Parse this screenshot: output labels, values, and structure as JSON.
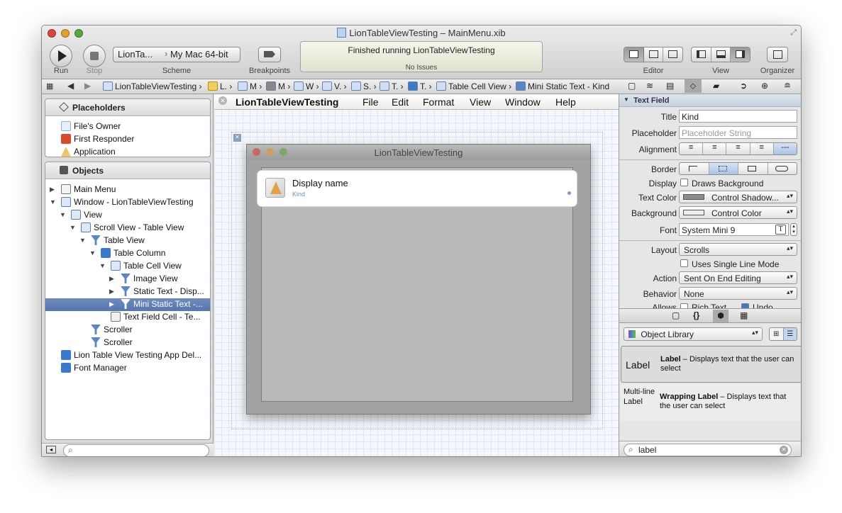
{
  "window": {
    "title": "LionTableViewTesting – MainMenu.xib"
  },
  "toolbar": {
    "run_label": "Run",
    "stop_label": "Stop",
    "scheme_target": "LionTa...",
    "scheme_destination": "My Mac 64-bit",
    "scheme_label": "Scheme",
    "breakpoints_label": "Breakpoints",
    "activity_status": "Finished running LionTableViewTesting",
    "activity_issues": "No Issues",
    "editor_label": "Editor",
    "view_label": "View",
    "organizer_label": "Organizer"
  },
  "jumpbar": {
    "crumbs": [
      "LionTableViewTesting",
      "L.",
      "M",
      "M",
      "W",
      "V.",
      "S.",
      "T.",
      "T.",
      "Table Cell View",
      "Mini Static Text - Kind"
    ]
  },
  "left": {
    "placeholders_title": "Placeholders",
    "placeholders": [
      "File's Owner",
      "First Responder",
      "Application"
    ],
    "objects_title": "Objects",
    "objects": [
      "Main Menu",
      "Window - LionTableViewTesting",
      "View",
      "Scroll View - Table View",
      "Table View",
      "Table Column",
      "Table Cell View",
      "Image View",
      "Static Text - Disp...",
      "Mini Static Text -...",
      "Text Field Cell - Te...",
      "Scroller",
      "Scroller",
      "Lion Table View Testing App Del...",
      "Font Manager"
    ]
  },
  "canvas": {
    "menus": [
      "LionTableViewTesting",
      "File",
      "Edit",
      "Format",
      "View",
      "Window",
      "Help"
    ],
    "window_title": "LionTableViewTesting",
    "cell_title": "Display name",
    "cell_subtitle": "Kind"
  },
  "inspector": {
    "section_title": "Text Field",
    "title_label": "Title",
    "title_value": "Kind",
    "placeholder_label": "Placeholder",
    "placeholder_value": "Placeholder String",
    "alignment_label": "Alignment",
    "border_label": "Border",
    "display_label": "Display",
    "draws_background": "Draws Background",
    "text_color_label": "Text Color",
    "text_color_value": "Control Shadow...",
    "background_label": "Background",
    "background_value": "Control Color",
    "font_label": "Font",
    "font_value": "System Mini 9",
    "layout_label": "Layout",
    "layout_value": "Scrolls",
    "single_line": "Uses Single Line Mode",
    "action_label": "Action",
    "action_value": "Sent On End Editing",
    "behavior_label": "Behavior",
    "behavior_value": "None",
    "allows_label": "Allows",
    "rich_text": "Rich Text",
    "undo": "Undo"
  },
  "library": {
    "selector": "Object Library",
    "item1_icon_label": "Label",
    "item1_name": "Label",
    "item1_desc": " – Displays text that the user can select",
    "item2_icon_label": "Multi-line Label",
    "item2_name": "Wrapping Label",
    "item2_desc": " – Displays text that the user can select",
    "search_value": "label"
  },
  "colors": {
    "selection": "#5576b0",
    "activity_bg": "#e6ebd9"
  }
}
